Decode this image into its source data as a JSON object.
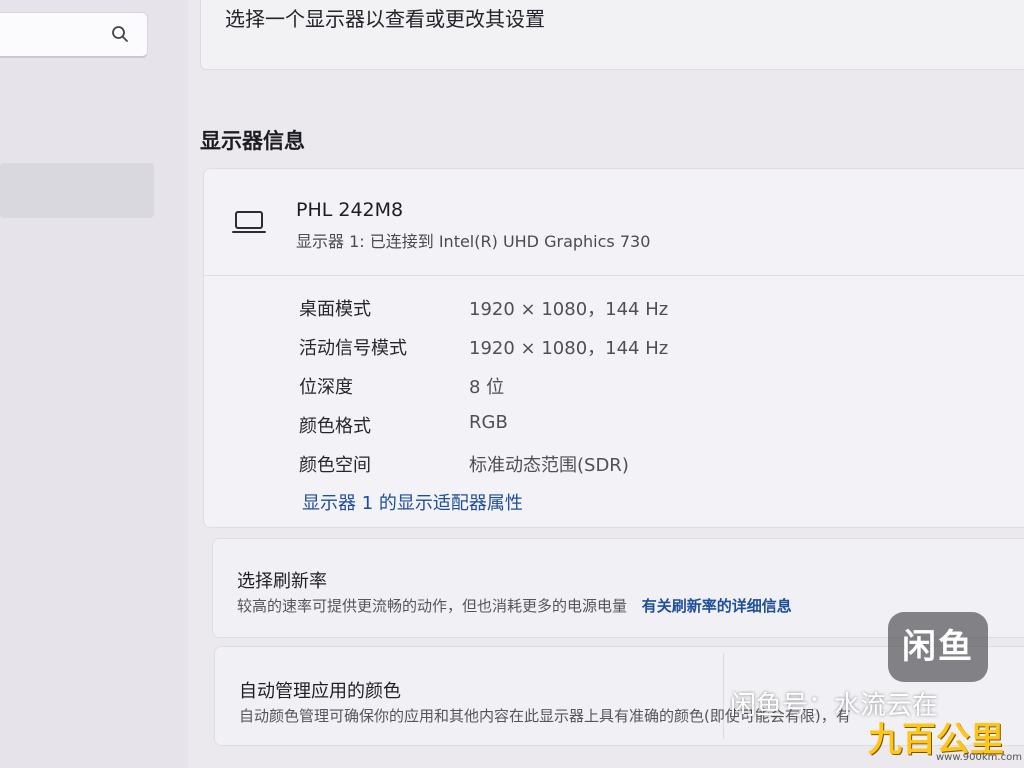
{
  "search": {
    "icon": "search-icon"
  },
  "header": {
    "select_display_text": "选择一个显示器以查看或更改其设置"
  },
  "section": {
    "title": "显示器信息"
  },
  "display_info": {
    "icon": "laptop-icon",
    "name": "PHL 242M8",
    "subtitle": "显示器 1: 已连接到 Intel(R) UHD Graphics 730",
    "rows": [
      {
        "label": "桌面模式",
        "value": "1920 × 1080，144 Hz"
      },
      {
        "label": "活动信号模式",
        "value": "1920 × 1080，144 Hz"
      },
      {
        "label": "位深度",
        "value": "8 位"
      },
      {
        "label": "颜色格式",
        "value": "RGB"
      },
      {
        "label": "颜色空间",
        "value": "标准动态范围(SDR)"
      }
    ],
    "adapter_link": "显示器 1 的显示适配器属性"
  },
  "refresh_rate": {
    "title": "选择刷新率",
    "description": "较高的速率可提供更流畅的动作，但也消耗更多的电源电量",
    "link": "有关刷新率的详细信息"
  },
  "color_management": {
    "title": "自动管理应用的颜色",
    "description": "自动颜色管理可确保你的应用和其他内容在此显示器上具有准确的颜色(即使可能会有限)，有"
  },
  "watermarks": {
    "logo": "闲鱼",
    "seller": "闲鱼号：水流云在",
    "corner_logo": "九百公里",
    "corner_url": "www.900km.com"
  },
  "colors": {
    "link": "#1f4e9a",
    "background": "#ebe9ee",
    "card": "#f3f2f6"
  }
}
